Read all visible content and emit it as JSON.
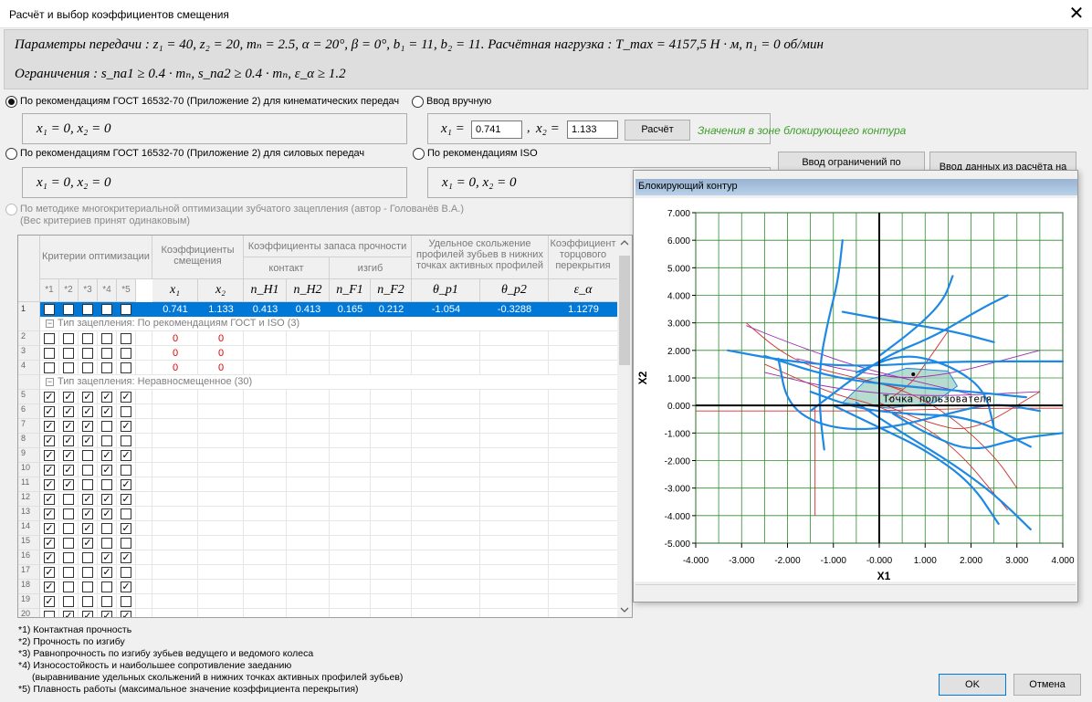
{
  "window": {
    "title": "Расчёт и выбор коэффициентов смещения",
    "close_glyph": "✕"
  },
  "params": {
    "line1": "Параметры передачи : z₁ = 40,  z₂ = 20, mₙ = 2.5, α = 20°,  β = 0°, b₁ = 11,  b₂ = 11. Расчётная нагрузка : T_max = 4157,5  Н · м, n₁ = 0 об/мин",
    "line2": "Ограничения : s_na1 ≥ 0.4 · mₙ,  s_na2 ≥ 0.4 · mₙ,  ε_α ≥ 1.2"
  },
  "options": {
    "gost_kin": {
      "label": "По рекомендациям ГОСТ 16532-70 (Приложение 2) для кинематических передач",
      "value": "x₁ = 0,  x₂ = 0",
      "selected": true
    },
    "manual": {
      "label": "Ввод вручную",
      "x1_label": "x₁ =",
      "x1": "0.741",
      "sep": ",",
      "x2_label": "x₂ =",
      "x2": "1.133",
      "calc_button": "Расчёт",
      "status": "Значения в зоне блокирующего контура"
    },
    "gost_power": {
      "label": "По рекомендациям ГОСТ 16532-70 (Приложение 2) для силовых передач",
      "value": "x₁ = 0,  x₂ = 0"
    },
    "iso": {
      "label": "По рекомендациям ISO",
      "value": "x₁ = 0,  x₂ = 0"
    },
    "multi": {
      "label_line1": "По методике многокритериальной оптимизации зубчатого зацепления (автор - Голованёв В.А.)",
      "label_line2": "(Вес критериев принят одинаковым)"
    }
  },
  "side_buttons": {
    "constraints": "Ввод ограничений по",
    "import": "Ввод данных из расчёта на"
  },
  "table": {
    "groups": {
      "criteria": "Критерии оптимизации",
      "coeffs": "Коэффициенты смещения",
      "safety": "Коэффициенты запаса прочности",
      "contact": "контакт",
      "bending": "изгиб",
      "sliding": "Удельное скольжение профилей зубьев в нижних точках активных профилей",
      "overlap": "Коэффициент торцового перекрытия"
    },
    "crit_cols": [
      "*1",
      "*2",
      "*3",
      "*4",
      "*5"
    ],
    "sym_cols": [
      "x₁",
      "x₂",
      "n_H1",
      "n_H2",
      "n_F1",
      "n_F2",
      "θ_p1",
      "θ_p2",
      "ε_α"
    ],
    "selected_row": {
      "num": "1",
      "values": [
        "0.741",
        "1.133",
        "0.413",
        "0.413",
        "0.165",
        "0.212",
        "-1.054",
        "-0.3288",
        "1.1279"
      ]
    },
    "group1": "Тип зацепления: По рекомендациям ГОСТ и ISO (3)",
    "group1_rows": [
      {
        "num": "2",
        "x1": "0",
        "x2": "0"
      },
      {
        "num": "3",
        "x1": "0",
        "x2": "0"
      },
      {
        "num": "4",
        "x1": "0",
        "x2": "0"
      }
    ],
    "group2": "Тип зацепления: Неравносмещенное (30)",
    "group2_rows": [
      {
        "num": "5",
        "c": [
          1,
          1,
          1,
          1,
          1
        ]
      },
      {
        "num": "6",
        "c": [
          1,
          1,
          1,
          1,
          0
        ]
      },
      {
        "num": "7",
        "c": [
          1,
          1,
          1,
          0,
          1
        ]
      },
      {
        "num": "8",
        "c": [
          1,
          1,
          1,
          0,
          0
        ]
      },
      {
        "num": "9",
        "c": [
          1,
          1,
          0,
          1,
          1
        ]
      },
      {
        "num": "10",
        "c": [
          1,
          1,
          0,
          1,
          0
        ]
      },
      {
        "num": "11",
        "c": [
          1,
          1,
          0,
          0,
          1
        ]
      },
      {
        "num": "12",
        "c": [
          1,
          0,
          1,
          1,
          1
        ]
      },
      {
        "num": "13",
        "c": [
          1,
          0,
          1,
          1,
          0
        ]
      },
      {
        "num": "14",
        "c": [
          1,
          0,
          1,
          0,
          1
        ]
      },
      {
        "num": "15",
        "c": [
          1,
          0,
          1,
          0,
          0
        ]
      },
      {
        "num": "16",
        "c": [
          1,
          0,
          0,
          1,
          1
        ]
      },
      {
        "num": "17",
        "c": [
          1,
          0,
          0,
          1,
          0
        ]
      },
      {
        "num": "18",
        "c": [
          1,
          0,
          0,
          0,
          1
        ]
      },
      {
        "num": "19",
        "c": [
          1,
          0,
          0,
          0,
          0
        ]
      },
      {
        "num": "20",
        "c": [
          0,
          1,
          1,
          1,
          1
        ]
      }
    ]
  },
  "notes": [
    "*1) Контактная прочность",
    "*2) Прочность по изгибу",
    "*3) Равнопрочность по изгибу зубьев ведущего и ведомого колеса",
    "*4) Износостойкость и наибольшее сопротивление заеданию",
    "(выравнивание удельных скольжений в нижних точках активных профилей зубьев)",
    "*5) Плавность работы (максимальное значение коэффициента перекрытия)"
  ],
  "footer": {
    "ok": "OK",
    "cancel": "Отмена"
  },
  "chart_window": {
    "caption": "Блокирующий контур"
  },
  "chart_data": {
    "type": "line",
    "xlabel": "X1",
    "ylabel": "X2",
    "xlim": [
      -4,
      4
    ],
    "ylim": [
      -5,
      7
    ],
    "xticks": [
      "-4.000",
      "-3.000",
      "-2.000",
      "-1.000",
      "-0.000",
      "1.000",
      "2.000",
      "3.000",
      "4.000"
    ],
    "yticks": [
      "7.000",
      "6.000",
      "5.000",
      "4.000",
      "3.000",
      "2.000",
      "1.000",
      "0.000",
      "-1.000",
      "-2.000",
      "-3.000",
      "-4.000",
      "-5.000"
    ],
    "grid": true,
    "colors": {
      "contour": "#1e88e5",
      "limits": "#d32f2f",
      "extra": "#9c27b0",
      "zone": "#9ecfc0",
      "grid": "#2e8b2e"
    },
    "point": {
      "x": 0.741,
      "y": 1.133,
      "label": "Точка пользователя"
    },
    "zone": [
      [
        -0.8,
        0.1
      ],
      [
        -0.3,
        0.9
      ],
      [
        0.6,
        1.35
      ],
      [
        1.5,
        1.25
      ],
      [
        1.7,
        0.7
      ],
      [
        1.2,
        0.1
      ],
      [
        0.2,
        -0.1
      ],
      [
        -0.8,
        0.1
      ]
    ],
    "blue_series": [
      {
        "values": [
          [
            -1.2,
            -1.6
          ],
          [
            -1.3,
            -0.2
          ],
          [
            -1.3,
            1.5
          ],
          [
            -1.1,
            3.2
          ],
          [
            -0.9,
            4.5
          ],
          [
            -0.8,
            6.0
          ]
        ]
      },
      {
        "values": [
          [
            -1.5,
            0.5
          ],
          [
            -0.5,
            -0.1
          ],
          [
            0.5,
            -0.3
          ],
          [
            2.0,
            -0.4
          ],
          [
            3.3,
            -1.5
          ]
        ]
      },
      {
        "values": [
          [
            -3.3,
            2.0
          ],
          [
            -2.0,
            1.6
          ],
          [
            -0.5,
            1.4
          ],
          [
            1.5,
            1.6
          ],
          [
            4.0,
            1.6
          ]
        ]
      },
      {
        "values": [
          [
            -2.5,
            1.8
          ],
          [
            -1.0,
            1.0
          ],
          [
            0.5,
            0.7
          ],
          [
            2.0,
            0.5
          ],
          [
            3.2,
            0.3
          ]
        ]
      },
      {
        "values": [
          [
            -0.5,
            1.2
          ],
          [
            0.5,
            1.9
          ],
          [
            1.5,
            1.5
          ],
          [
            2.3,
            0.6
          ],
          [
            2.5,
            -0.8
          ]
        ]
      },
      {
        "values": [
          [
            -1.5,
            -0.2
          ],
          [
            0.0,
            1.7
          ],
          [
            1.2,
            2.5
          ],
          [
            2.2,
            3.5
          ],
          [
            2.8,
            4.0
          ]
        ]
      },
      {
        "values": [
          [
            0.0,
            1.8
          ],
          [
            0.8,
            2.8
          ],
          [
            1.4,
            3.8
          ],
          [
            1.6,
            4.7
          ]
        ]
      },
      {
        "values": [
          [
            -0.5,
            0.1
          ],
          [
            0.5,
            -1.0
          ],
          [
            1.5,
            -2.0
          ],
          [
            2.5,
            -3.2
          ],
          [
            3.3,
            -4.5
          ]
        ]
      },
      {
        "values": [
          [
            0.3,
            -0.3
          ],
          [
            1.0,
            -1.0
          ],
          [
            2.0,
            -1.7
          ],
          [
            3.0,
            -1.2
          ],
          [
            4.0,
            -1.0
          ]
        ]
      },
      {
        "values": [
          [
            -0.8,
            3.4
          ],
          [
            0.5,
            3.0
          ],
          [
            1.6,
            2.7
          ],
          [
            2.5,
            2.3
          ]
        ]
      },
      {
        "values": [
          [
            -2.2,
            1.7
          ],
          [
            -2.0,
            0.0
          ],
          [
            -1.2,
            -0.8
          ],
          [
            0.0,
            -0.9
          ],
          [
            1.5,
            -0.3
          ],
          [
            2.5,
            0.1
          ],
          [
            3.5,
            -0.2
          ]
        ]
      },
      {
        "values": [
          [
            -1.0,
            0.0
          ],
          [
            0.0,
            -0.8
          ],
          [
            1.0,
            -1.6
          ],
          [
            2.0,
            -2.8
          ],
          [
            2.6,
            -4.3
          ]
        ]
      }
    ],
    "red_series": [
      {
        "values": [
          [
            -2.9,
            3.0
          ],
          [
            -2.2,
            2.0
          ],
          [
            -1.5,
            1.4
          ],
          [
            -0.5,
            1.0
          ],
          [
            0.5,
            0.6
          ]
        ]
      },
      {
        "values": [
          [
            -1.4,
            -4.0
          ],
          [
            -1.4,
            -1.5
          ],
          [
            -1.4,
            0.0
          ]
        ]
      },
      {
        "values": [
          [
            -4.0,
            -0.2
          ],
          [
            -2.0,
            -0.2
          ],
          [
            0.0,
            -0.2
          ],
          [
            2.0,
            -0.1
          ],
          [
            4.0,
            -0.1
          ]
        ]
      },
      {
        "values": [
          [
            1.5,
            2.7
          ],
          [
            1.0,
            1.5
          ],
          [
            0.7,
            0.8
          ],
          [
            0.2,
            0.2
          ]
        ]
      },
      {
        "values": [
          [
            -0.5,
            1.0
          ],
          [
            0.5,
            0.6
          ],
          [
            1.5,
            -0.3
          ],
          [
            2.5,
            -1.8
          ],
          [
            3.0,
            -3.0
          ]
        ]
      },
      {
        "values": [
          [
            0.0,
            0.1
          ],
          [
            1.0,
            -0.6
          ],
          [
            2.0,
            -1.0
          ],
          [
            3.5,
            0.5
          ]
        ]
      },
      {
        "values": [
          [
            -2.5,
            1.5
          ],
          [
            -1.0,
            0.4
          ],
          [
            0.0,
            0.0
          ],
          [
            1.5,
            -1.2
          ],
          [
            2.8,
            -3.8
          ]
        ]
      }
    ],
    "purple_series": [
      {
        "values": [
          [
            -1.8,
            1.7
          ],
          [
            -0.5,
            1.2
          ],
          [
            1.0,
            0.9
          ],
          [
            3.5,
            2.0
          ]
        ]
      },
      {
        "values": [
          [
            -2.5,
            1.2
          ],
          [
            -1.0,
            0.6
          ],
          [
            1.0,
            0.3
          ],
          [
            3.5,
            0.5
          ]
        ]
      },
      {
        "values": [
          [
            -2.9,
            2.9
          ],
          [
            -2.0,
            2.3
          ],
          [
            -0.5,
            1.4
          ],
          [
            1.0,
            0.8
          ],
          [
            2.0,
            0.4
          ]
        ]
      }
    ]
  }
}
